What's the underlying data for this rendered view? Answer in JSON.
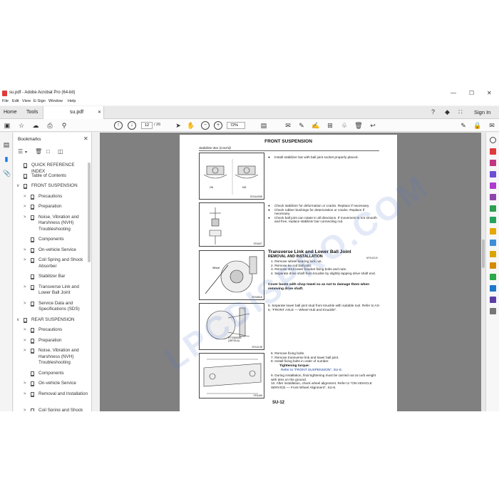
{
  "window": {
    "title": "su.pdf - Adobe Acrobat Pro (64-bit)",
    "controls": [
      "—",
      "☐",
      "✕"
    ]
  },
  "menu": [
    "File",
    "Edit",
    "View",
    "E-Sign",
    "Window",
    "Help"
  ],
  "tabs": {
    "home": "Home",
    "tools": "Tools",
    "file": "su.pdf",
    "file_close": "✕",
    "sign_in": "Sign In"
  },
  "toolbar": {
    "page_current": "12",
    "page_total": "/ 26",
    "zoom": "72%"
  },
  "bookmarks": {
    "heading": "Bookmarks",
    "items": [
      {
        "label": "QUICK REFERENCE INDEX",
        "level": 0,
        "expand": ""
      },
      {
        "label": "Table of Contents",
        "level": 0,
        "expand": ""
      },
      {
        "label": "FRONT SUSPENSION",
        "level": 0,
        "expand": "∨"
      },
      {
        "label": "Precautions",
        "level": 1,
        "expand": ">"
      },
      {
        "label": "Preparation",
        "level": 1,
        "expand": ">"
      },
      {
        "label": "Noise, Vibration and Harshness (NVH) Troubleshooting",
        "level": 1,
        "expand": ">"
      },
      {
        "label": "Components",
        "level": 1,
        "expand": ""
      },
      {
        "label": "On-vehicle Service",
        "level": 1,
        "expand": ">"
      },
      {
        "label": "Coil Spring and Shock Absorber",
        "level": 1,
        "expand": ">"
      },
      {
        "label": "Stabilizer Bar",
        "level": 1,
        "expand": ""
      },
      {
        "label": "Transverse Link and Lower Ball Joint",
        "level": 1,
        "expand": ">"
      },
      {
        "label": "Service Data and Specifications (SDS)",
        "level": 1,
        "expand": ">"
      },
      {
        "label": "REAR SUSPENSION",
        "level": 0,
        "expand": "∨"
      },
      {
        "label": "Precautions",
        "level": 1,
        "expand": ">"
      },
      {
        "label": "Preparation",
        "level": 1,
        "expand": ">"
      },
      {
        "label": "Noise, Vibration and Harshness (NVH) Troubleshooting",
        "level": 1,
        "expand": ">"
      },
      {
        "label": "Components",
        "level": 1,
        "expand": ""
      },
      {
        "label": "On-vehicle Service",
        "level": 1,
        "expand": ">"
      },
      {
        "label": "Removal and Installation",
        "level": 1,
        "expand": ">"
      },
      {
        "label": "Coil Spring and Shock Absorber",
        "level": 1,
        "expand": ">"
      }
    ]
  },
  "doc": {
    "title": "FRONT SUSPENSION",
    "subtitle": "Stabilizer Bar (Cont'd)",
    "figure_codes": [
      "SFA440BB",
      "SFA607",
      "SFA881B",
      "SFA313B",
      "SFA468"
    ],
    "figure_labels": {
      "ok": "OK",
      "ng": "NG",
      "wheel": "Wheel",
      "tool": "HT72520000 (J25730-A)"
    },
    "text_install_bar": "Install stabilizer bar with ball joint socket properly placed.",
    "checks": [
      "Check stabilizer for deformation or cracks. Replace if necessary.",
      "Check rubber bushings for deterioration or cracks. Replace if necessary.",
      "Check ball joint can rotate in all directions. If movement is not smooth and free, replace stabilizer bar connecting rod."
    ],
    "section_title": "Transverse Link and Lower Ball Joint",
    "section_sub": "REMOVAL AND INSTALLATION",
    "section_code": "NFSU0019",
    "steps_a": [
      "1. Remove wheel bearing lock nut.",
      "2. Remove tie-rod ball joint.",
      "3. Remove strut lower bracket fixing bolts and nuts.",
      "4. Separate drive shaft from knuckle by slightly tapping drive shaft end."
    ],
    "caution": "Cover boots with shop towel so as not to damage them when removing drive shaft.",
    "step_5": "5. Separate lower ball joint stud from knuckle with suitable tool. Refer to AX-5, \"FRONT AXLE — Wheel Hub and Knuckle\".",
    "steps_b": [
      "6. Remove fixing bolts.",
      "7. Remove transverse link and lower ball joint.",
      "8. Install fixing bolts in order of number."
    ],
    "torque_label": "Tightening torque:",
    "torque_ref": "Refer to \"FRONT SUSPENSION\", SU-8.",
    "steps_c": [
      "9. During installation, final tightening must be carried out at curb weight with tires on the ground.",
      "10. After installation, check wheel alignment. Refer to \"ON-VEHICLE SERVICE — Front Wheel Alignment\", SU-6."
    ],
    "page_number": "SU-12"
  },
  "watermark": "LPCDISPRO.COM",
  "colors": {
    "accent": "#1473e6",
    "pdf_red": "#e03a3a"
  }
}
